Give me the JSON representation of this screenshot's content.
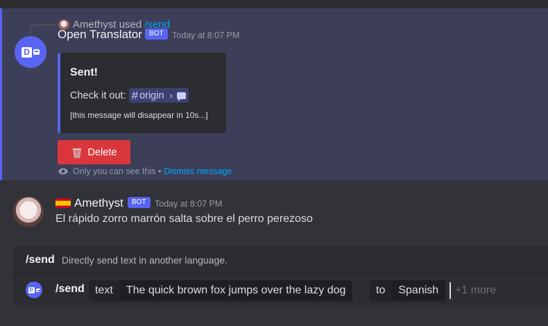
{
  "ephemeral": {
    "reply": {
      "user": "Amethyst",
      "used": "used",
      "command": "/send"
    },
    "bot_name": "Open Translator",
    "bot_badge": "BOT",
    "timestamp": "Today at 8:07 PM",
    "embed": {
      "title": "Sent!",
      "check_label": "Check it out:",
      "channel": "origin",
      "note": "[this message will disappear in 10s...]"
    },
    "delete_button": "Delete",
    "only_you": "Only you can see this •",
    "dismiss": "Dismiss message"
  },
  "message": {
    "author": "Amethyst",
    "badge": "BOT",
    "timestamp": "Today at 8:07 PM",
    "text": "El rápido zorro marrón salta sobre el perro perezoso"
  },
  "command_panel": {
    "name": "/send",
    "description": "Directly send text in another language.",
    "input_command": "/send",
    "options": [
      {
        "key": "text",
        "value": "The quick brown fox jumps over the lazy dog"
      },
      {
        "key": "to",
        "value": "Spanish"
      }
    ],
    "more": "+1 more"
  },
  "colors": {
    "accent": "#5865f2",
    "danger": "#da373c",
    "link": "#00a8fc",
    "background": "#313338"
  }
}
